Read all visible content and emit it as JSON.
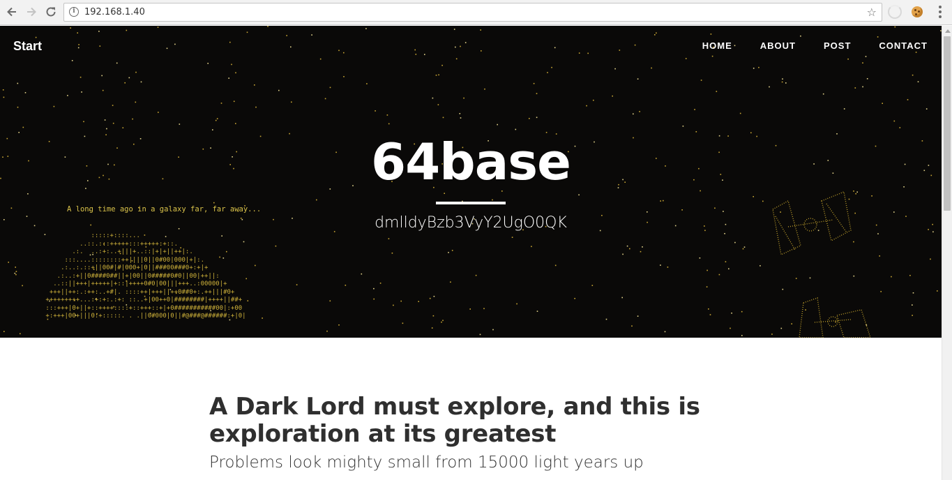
{
  "browser": {
    "url": "192.168.1.40",
    "back_icon": "arrow-left-icon",
    "forward_icon": "arrow-right-icon",
    "reload_icon": "reload-icon",
    "info_icon": "info-icon",
    "bookmark_icon": "star-icon",
    "extension_icons": [
      "sync-extension-icon",
      "cookie-extension-icon"
    ],
    "menu_icon": "kebab-menu-icon"
  },
  "site": {
    "brand": "Start",
    "nav": [
      {
        "label": "HOME"
      },
      {
        "label": "ABOUT"
      },
      {
        "label": "POST"
      },
      {
        "label": "CONTACT"
      }
    ]
  },
  "hero": {
    "title": "64base",
    "subtitle": "dmlldyBzb3VyY2UgO0QK",
    "crawl_text": "A long time ago in a galaxy far, far away...",
    "ascii_art": "             :::::+::::...\n          ..::.:::+++++:::+++++:+::.\n        .:.  ..:+:..+|||+..::|+|+||++|:.\n      :::....::::::::++||||0||0#00|000|+|:.\n     .:..:.::+||00#|#|000+|0||###00###0+:+|+\n    .:..:+||0####0##||+|00||0#####0#0||00|++||:\n   ..::||+++|+++++|+::|++++0#0|00|||+++..:00000|+\n  +++||++:.:++:..+#|. ::::++|+++||++0##0+:.++|||#0+\n +++++++++...:+:+:.:+: ::..+|00++0|########|++++||##+\n :::+++|0+||+::++++::::+::+++::+|+0###########00|:+00\n +:+++|00+|||0:+:::::. . .||0#000|0||#@###@######:+|0|\n      ",
    "background": "#0a0908",
    "accent": "#cfb23a",
    "decoration_icons": [
      "tie-fighter-icon",
      "tie-fighter-icon"
    ]
  },
  "post": {
    "title": "A Dark Lord must explore, and this is exploration at its greatest",
    "subtitle": "Problems look mighty small from 15000 light years up"
  }
}
